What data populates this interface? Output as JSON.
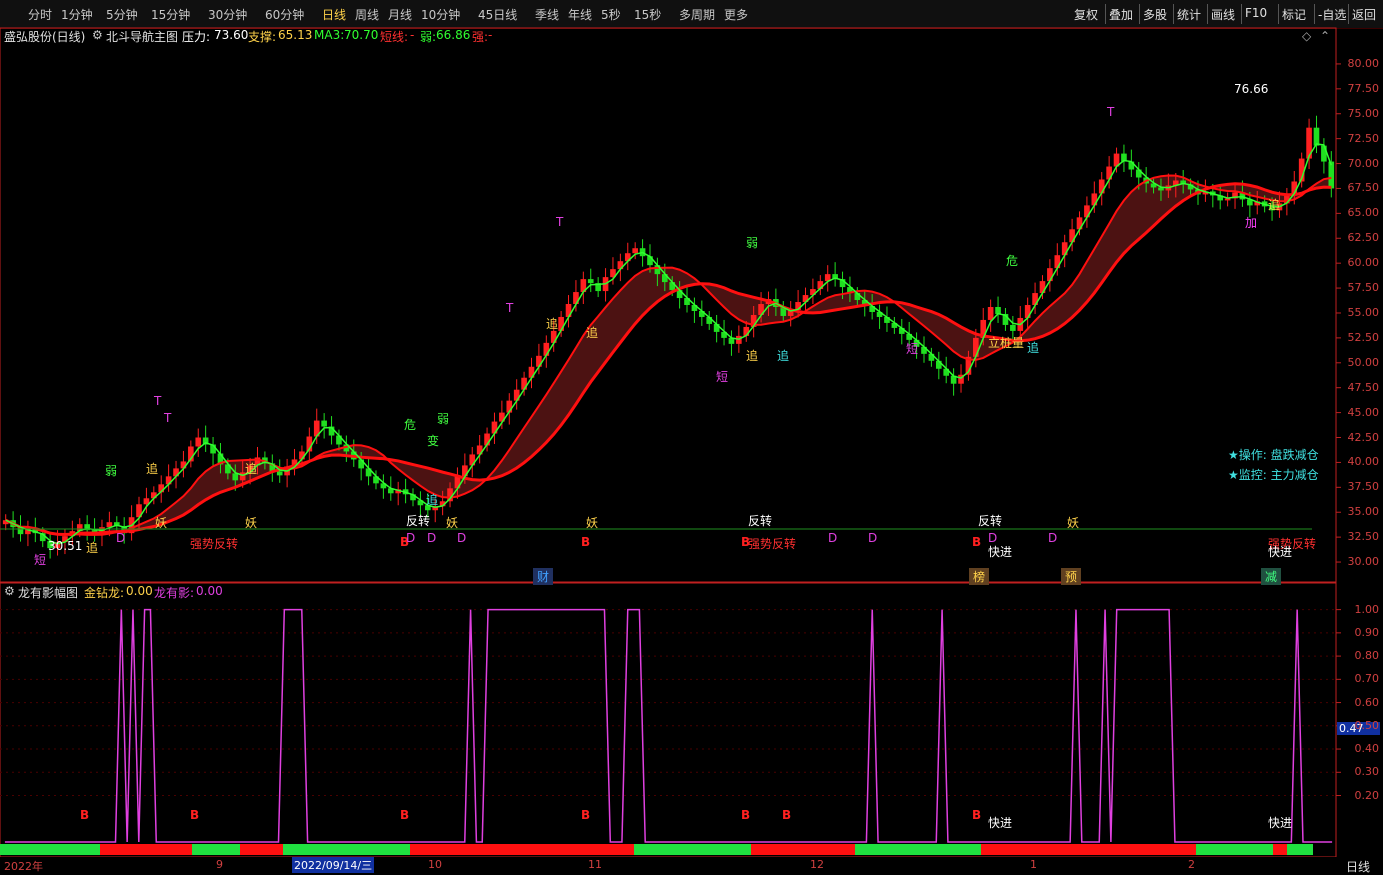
{
  "toolbar": {
    "periods": [
      "分时",
      "1分钟",
      "5分钟",
      "15分钟",
      "30分钟",
      "60分钟",
      "日线",
      "周线",
      "月线",
      "10分钟",
      "45日线",
      "季线",
      "年线",
      "5秒",
      "15秒",
      "多周期",
      "更多"
    ],
    "active_period": "日线",
    "right_items": [
      "复权",
      "叠加",
      "多股",
      "统计",
      "画线",
      "F10",
      "标记",
      "-自选",
      "返回"
    ]
  },
  "main_panel": {
    "stock": "盛弘股份(日线)",
    "indicator": "北斗导航主图",
    "pressure_label": "压力:",
    "pressure_value": "73.60",
    "support_label": "支撑:",
    "support_value": "65.13",
    "ma3_label": "MA3:",
    "ma3_value": "70.70",
    "short_label": "短线:",
    "short_value": "-",
    "weak_label": "弱:",
    "weak_value": "66.86",
    "strong_label": "强:",
    "strong_value": "-",
    "high_label": "76.66",
    "low_label": "30.51",
    "ops_line": "★操作: 盘跌减仓",
    "monitor_line": "★监控: 主力减仓"
  },
  "sub_panel": {
    "indicator": "龙有影幅图",
    "gold_label": "金钻龙:",
    "gold_value": "0.00",
    "shadow_label": "龙有影:",
    "shadow_value": "0.00",
    "current_value": "0.47"
  },
  "annotations": {
    "yao": "妖",
    "fanzhuan": "反转",
    "cai": "财",
    "bang": "榜",
    "yu": "预",
    "jian": "减",
    "kuaijin": "快进",
    "qiangshi_fanzhuan": "强势反转",
    "zhui": "追",
    "duan": "短",
    "ruo": "弱",
    "wei": "危",
    "bian": "变",
    "T": "T",
    "B": "B",
    "D": "D",
    "jia": "加",
    "lizhuang": "立桩量"
  },
  "time_axis": {
    "labels": [
      "2022年",
      "9",
      "2022/09/14/三",
      "10",
      "11",
      "12",
      "1",
      "2"
    ],
    "period_label": "日线"
  },
  "chart_data": [
    {
      "type": "candlestick",
      "title": "北斗导航主图",
      "ylim": [
        29,
        82
      ],
      "yticks": [
        30.0,
        32.5,
        35.0,
        37.5,
        40.0,
        42.5,
        45.0,
        47.5,
        50.0,
        52.5,
        55.0,
        57.5,
        60.0,
        62.5,
        65.0,
        67.5,
        70.0,
        72.5,
        75.0,
        77.5,
        80.0
      ],
      "close": [
        34.2,
        33.5,
        32.8,
        33.4,
        32.9,
        32.1,
        31.4,
        32.0,
        32.6,
        33.1,
        33.8,
        33.2,
        32.8,
        33.5,
        34.0,
        33.6,
        32.9,
        34.5,
        35.8,
        36.4,
        37.0,
        37.8,
        38.6,
        39.4,
        40.1,
        41.6,
        42.5,
        41.8,
        40.9,
        39.8,
        38.9,
        38.2,
        39.0,
        39.7,
        40.5,
        39.9,
        39.1,
        38.7,
        39.6,
        40.3,
        41.1,
        42.6,
        44.2,
        43.6,
        42.7,
        41.8,
        41.1,
        40.3,
        39.4,
        38.6,
        37.9,
        37.4,
        36.9,
        37.3,
        36.8,
        36.2,
        35.7,
        35.2,
        35.6,
        36.1,
        37.4,
        38.6,
        39.7,
        40.8,
        41.7,
        42.9,
        44.1,
        45.0,
        46.2,
        47.3,
        48.5,
        49.6,
        50.7,
        52.0,
        53.2,
        54.6,
        55.9,
        57.1,
        58.4,
        58.0,
        57.2,
        58.6,
        59.4,
        60.2,
        61.0,
        61.5,
        60.7,
        59.8,
        58.9,
        58.1,
        57.3,
        56.5,
        55.8,
        55.2,
        54.6,
        53.9,
        53.1,
        52.5,
        51.9,
        52.7,
        53.6,
        54.8,
        55.9,
        56.4,
        55.6,
        54.7,
        55.3,
        56.1,
        56.8,
        57.4,
        58.2,
        58.9,
        58.4,
        57.6,
        57.0,
        56.3,
        55.7,
        55.1,
        54.6,
        54.0,
        53.5,
        52.9,
        52.3,
        51.6,
        50.9,
        50.2,
        49.4,
        48.7,
        47.9,
        48.8,
        50.6,
        52.5,
        54.3,
        55.6,
        54.9,
        53.8,
        53.2,
        54.5,
        55.8,
        57.0,
        58.2,
        59.5,
        60.8,
        62.1,
        63.4,
        64.6,
        65.8,
        67.0,
        68.4,
        69.7,
        71.0,
        70.2,
        69.4,
        68.6,
        68.0,
        67.6,
        67.3,
        67.8,
        68.3,
        67.9,
        67.4,
        66.9,
        67.2,
        66.8,
        66.3,
        66.5,
        67.1,
        66.4,
        65.8,
        66.2,
        65.7,
        65.3,
        66.0,
        66.8,
        68.2,
        70.5,
        73.6,
        71.8,
        70.2,
        67.5
      ],
      "lines": {
        "MA3": "green",
        "短线": "red",
        "弱": "red"
      }
    },
    {
      "type": "line",
      "title": "龙有影幅图",
      "ylim": [
        0,
        1.05
      ],
      "yticks": [
        0.2,
        0.3,
        0.4,
        0.5,
        0.6,
        0.7,
        0.8,
        0.9,
        1.0
      ],
      "series": [
        {
          "name": "龙有影",
          "color": "#e040e0",
          "values": [
            0,
            0,
            0,
            0,
            0,
            0,
            0,
            0,
            0,
            0,
            0,
            0,
            0,
            0,
            0,
            0,
            0,
            0,
            0,
            0,
            1,
            0,
            1,
            0,
            1,
            1,
            0,
            0,
            0,
            0,
            0,
            0,
            0,
            0,
            0,
            0,
            0,
            0,
            0,
            0,
            0,
            0,
            0,
            0,
            0,
            0,
            0,
            0,
            1,
            1,
            1,
            1,
            0,
            0,
            0,
            0,
            0,
            0,
            0,
            0,
            0,
            0,
            0,
            0,
            0,
            0,
            0,
            0,
            0,
            0,
            0,
            0,
            0,
            0,
            0,
            0,
            0,
            0,
            0,
            0,
            1,
            0,
            0,
            1,
            1,
            1,
            1,
            1,
            1,
            1,
            1,
            1,
            1,
            1,
            1,
            1,
            1,
            1,
            1,
            1,
            1,
            1,
            1,
            1,
            0,
            0,
            0,
            1,
            1,
            1,
            0,
            0,
            0,
            0,
            0,
            0,
            0,
            0,
            0,
            0,
            0,
            0,
            0,
            0,
            0,
            0,
            0,
            0,
            0,
            0,
            0,
            0,
            0,
            0,
            0,
            0,
            0,
            0,
            0,
            0,
            0,
            0,
            0,
            0,
            0,
            0,
            0,
            0,
            0,
            1,
            0,
            0,
            0,
            0,
            0,
            0,
            0,
            0,
            0,
            0,
            0,
            1,
            0,
            0,
            0,
            0,
            0,
            0,
            0,
            0,
            0,
            0,
            0,
            0,
            0,
            0,
            0,
            0,
            0,
            0,
            0,
            0,
            0,
            0,
            1,
            0,
            0,
            0,
            0,
            1,
            0,
            1,
            1,
            1,
            1,
            1,
            1,
            1,
            1,
            1,
            1,
            0,
            0,
            0,
            0,
            0,
            0,
            0,
            0,
            0,
            0,
            0,
            0,
            0,
            0,
            0,
            0,
            0,
            0,
            0,
            0,
            0,
            1,
            0,
            0,
            0,
            0,
            0,
            0
          ]
        }
      ]
    }
  ],
  "colors": {
    "up": "#ff2020",
    "down": "#20e020",
    "ma3": "#30ff30",
    "short": "#ff1010",
    "axis": "#c02020",
    "accent": "#ffd24a",
    "magenta": "#e040e0",
    "cyan": "#40e0e0"
  }
}
